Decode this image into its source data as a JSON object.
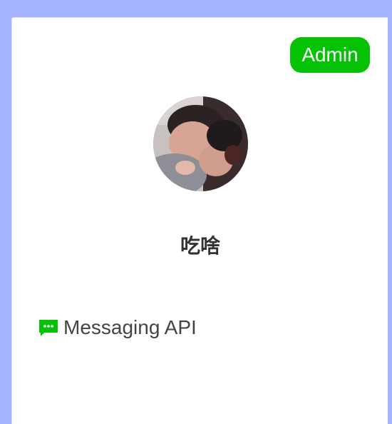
{
  "card": {
    "role_badge": "Admin",
    "name": "吃啥",
    "feature": {
      "icon": "message-icon",
      "label": "Messaging API"
    }
  },
  "colors": {
    "badge_bg": "#06c206",
    "icon_green": "#06c206",
    "page_bg": "#a4b4ff"
  }
}
